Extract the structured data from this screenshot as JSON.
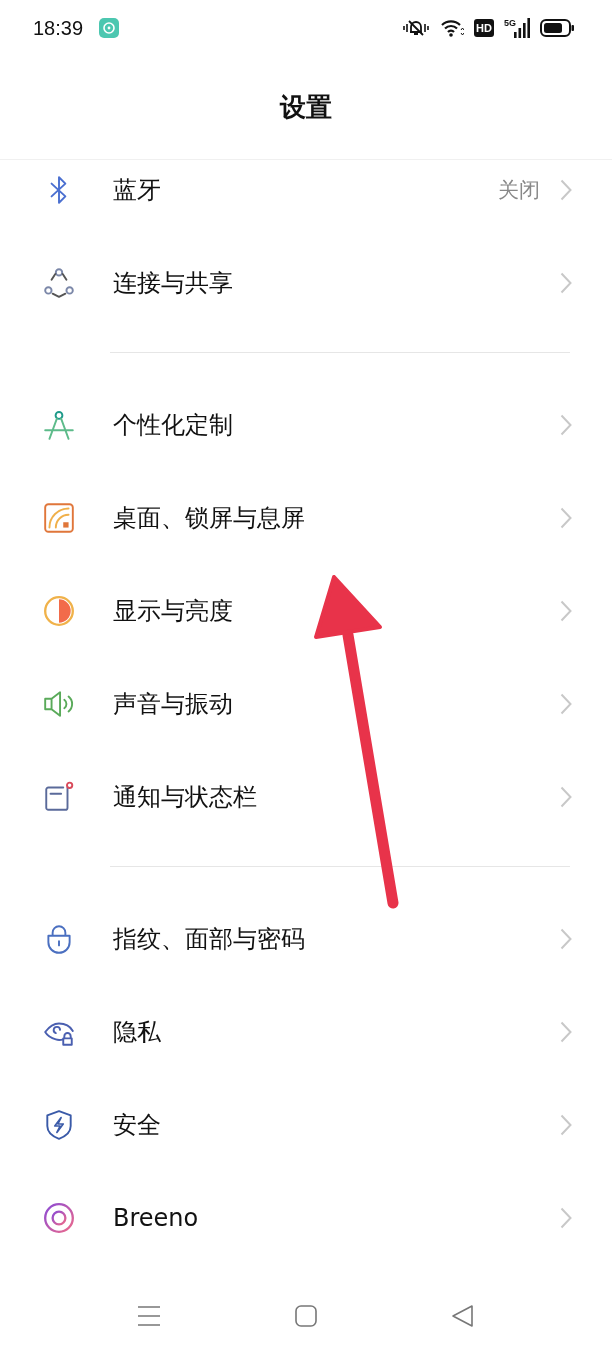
{
  "status_bar": {
    "time": "18:39",
    "hd": "HD",
    "network": "5G"
  },
  "header": {
    "title": "设置"
  },
  "groups": [
    {
      "items": [
        {
          "label": "蓝牙",
          "value": "关闭"
        },
        {
          "label": "连接与共享"
        }
      ]
    },
    {
      "items": [
        {
          "label": "个性化定制"
        },
        {
          "label": "桌面、锁屏与息屏"
        },
        {
          "label": "显示与亮度"
        },
        {
          "label": "声音与振动"
        },
        {
          "label": "通知与状态栏"
        }
      ]
    },
    {
      "items": [
        {
          "label": "指纹、面部与密码"
        },
        {
          "label": "隐私"
        },
        {
          "label": "安全"
        },
        {
          "label": "Breeno"
        }
      ]
    }
  ]
}
